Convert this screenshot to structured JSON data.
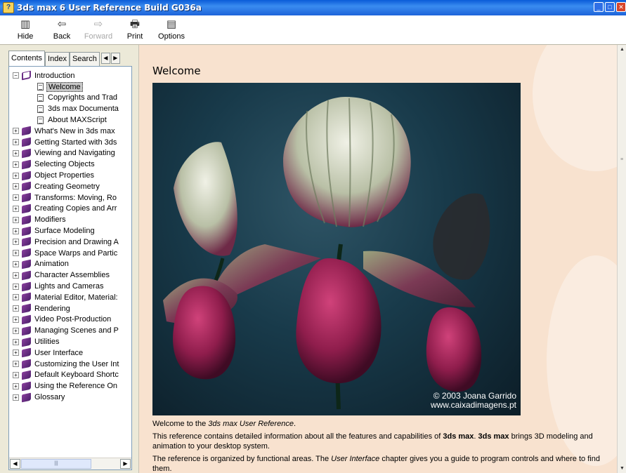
{
  "window": {
    "title": "3ds max 6 User Reference Build G036a",
    "controls": [
      "minimize",
      "maximize",
      "close"
    ]
  },
  "toolbar": {
    "buttons": [
      {
        "label": "Hide",
        "icon": "hide-pane-icon",
        "enabled": true
      },
      {
        "label": "Back",
        "icon": "back-arrow-icon",
        "enabled": true
      },
      {
        "label": "Forward",
        "icon": "forward-arrow-icon",
        "enabled": false
      },
      {
        "label": "Print",
        "icon": "printer-icon",
        "enabled": true
      },
      {
        "label": "Options",
        "icon": "options-icon",
        "enabled": true
      }
    ]
  },
  "navpane": {
    "tabs": [
      {
        "label": "Contents",
        "active": true
      },
      {
        "label": "Index",
        "active": false
      },
      {
        "label": "Search",
        "active": false
      }
    ],
    "tree": {
      "root": {
        "label": "Introduction",
        "expanded": true
      },
      "children": [
        {
          "label": "Welcome",
          "selected": true
        },
        {
          "label": "Copyrights and Trad"
        },
        {
          "label": "3ds max Documenta"
        },
        {
          "label": "About MAXScript"
        }
      ],
      "books": [
        "What's New in 3ds max",
        "Getting Started with 3ds",
        "Viewing and Navigating",
        "Selecting Objects",
        "Object Properties",
        "Creating Geometry",
        "Transforms: Moving, Ro",
        "Creating Copies and Arr",
        "Modifiers",
        "Surface Modeling",
        "Precision and Drawing A",
        "Space Warps and Partic",
        "Animation",
        "Character Assemblies",
        "Lights and Cameras",
        "Material Editor, Material:",
        "Rendering",
        "Video Post-Production",
        "Managing Scenes and P",
        "Utilities",
        "User Interface",
        "Customizing the User Int",
        "Default Keyboard Shortc",
        "Using the Reference On",
        "Glossary"
      ]
    }
  },
  "content": {
    "heading": "Welcome",
    "image_credit_line1": "© 2003 Joana Garrido",
    "image_credit_line2": "www.caixadimagens.pt",
    "para1_pre": "Welcome to the ",
    "para1_em": "3ds max User Reference",
    "para1_post": ".",
    "para2_a": "This reference contains detailed information about all the features and capabilities of ",
    "para2_b1": "3ds max",
    "para2_c": ". ",
    "para2_b2": "3ds max",
    "para2_d": " brings 3D modeling and animation to your desktop system.",
    "para3_a": "The reference is organized by functional areas. The ",
    "para3_em": "User Interface",
    "para3_b": " chapter gives you a guide to program controls and where to find them."
  },
  "colors": {
    "content_bg": "#f8e2cf",
    "selection": "#c8c8c8",
    "book": "#6b2e86"
  }
}
